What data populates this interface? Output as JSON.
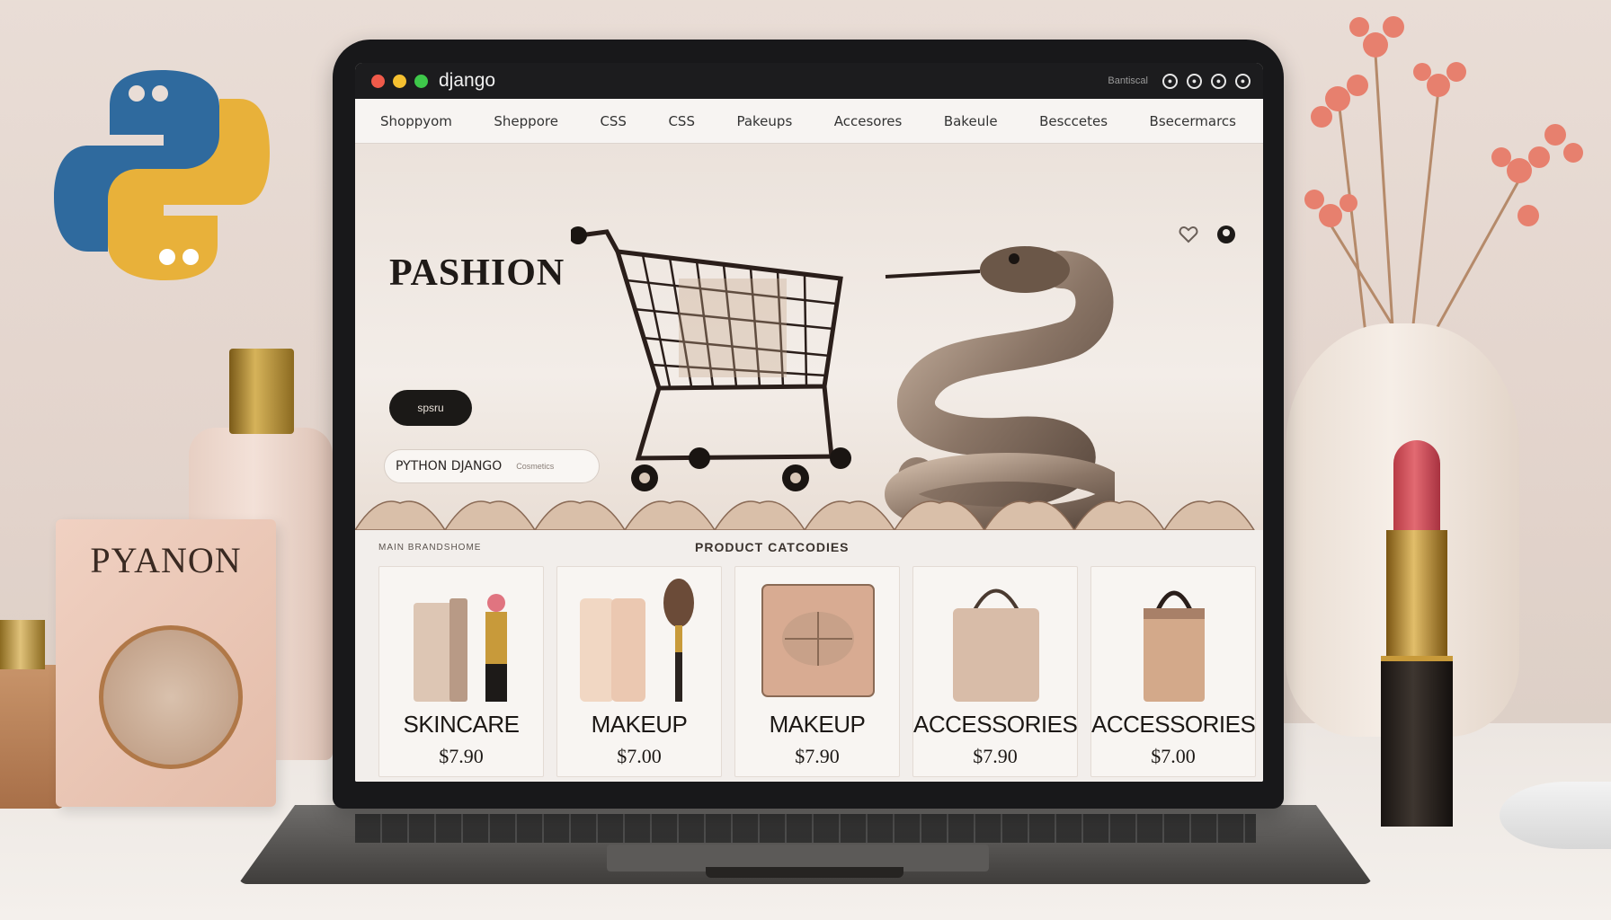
{
  "scene": {
    "box_label": "PYANON"
  },
  "window": {
    "app_title": "django",
    "chrome_text": "Bantiscal",
    "icons": [
      "profile-icon",
      "cart-icon",
      "account-icon",
      "user-icon"
    ]
  },
  "nav": {
    "items": [
      {
        "label": "Shoppyom"
      },
      {
        "label": "Sheppore"
      },
      {
        "label": "CSS"
      },
      {
        "label": "CSS"
      },
      {
        "label": "Pakeups"
      },
      {
        "label": "Accesores"
      },
      {
        "label": "Bakeule"
      },
      {
        "label": "Besccetes"
      },
      {
        "label": "Bsecermarcs"
      }
    ]
  },
  "hero": {
    "title": "PASHION",
    "button_label": "spsru",
    "search_value": "PYTHON DJANGO",
    "search_hint": "Cosmetics",
    "icons": [
      "heart-icon",
      "user-icon"
    ]
  },
  "products": {
    "left_label": "MAIN BRANDSHOME",
    "section_title": "PRODUCT CATCODIES",
    "items": [
      {
        "name": "SKINCARE",
        "price": "$7.90",
        "icon": "skincare-product-icon"
      },
      {
        "name": "MAKEUP",
        "price": "$7.00",
        "icon": "makeup-brush-icon"
      },
      {
        "name": "MAKEUP",
        "price": "$7.90",
        "icon": "compact-powder-icon"
      },
      {
        "name": "ACCESSORIES",
        "price": "$7.90",
        "icon": "handbag-icon"
      },
      {
        "name": "ACCESSORIES",
        "price": "$7.00",
        "icon": "tote-bag-icon"
      }
    ]
  },
  "colors": {
    "accent": "#1b1917",
    "background": "#f0ebe6"
  }
}
